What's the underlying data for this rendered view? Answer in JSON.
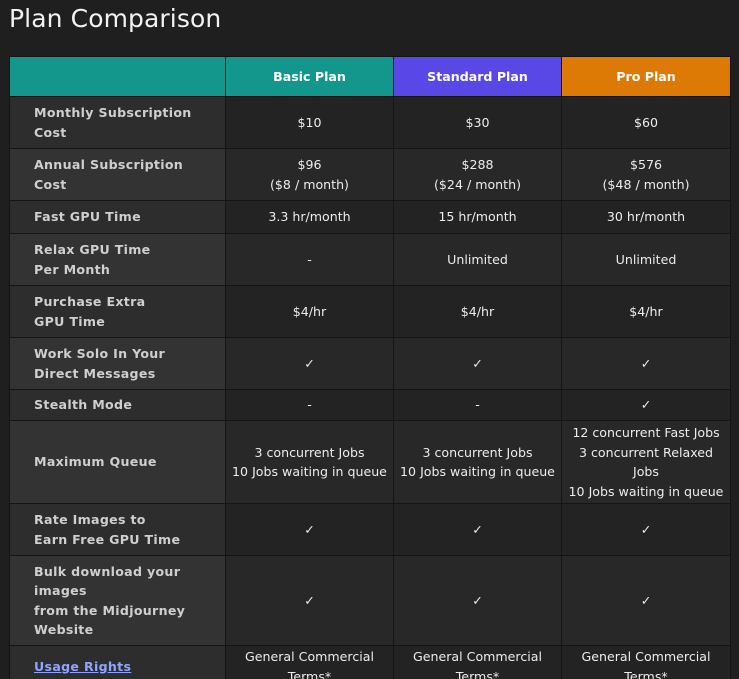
{
  "page": {
    "title": "Plan Comparison"
  },
  "plans": [
    {
      "name": "Basic Plan",
      "color": "#13978d"
    },
    {
      "name": "Standard Plan",
      "color": "#5a48e6"
    },
    {
      "name": "Pro Plan",
      "color": "#dd7a06"
    }
  ],
  "rows": [
    {
      "label": [
        "Monthly Subscription",
        "Cost"
      ],
      "values": [
        [
          "$10"
        ],
        [
          "$30"
        ],
        [
          "$60"
        ]
      ]
    },
    {
      "label": [
        "Annual Subscription Cost"
      ],
      "values": [
        [
          "$96",
          "($8 / month)"
        ],
        [
          "$288",
          "($24 / month)"
        ],
        [
          "$576",
          "($48 / month)"
        ]
      ]
    },
    {
      "label": [
        "Fast GPU Time"
      ],
      "values": [
        [
          "3.3 hr/month"
        ],
        [
          "15 hr/month"
        ],
        [
          "30 hr/month"
        ]
      ]
    },
    {
      "label": [
        "Relax GPU Time",
        "Per Month"
      ],
      "values": [
        [
          "-"
        ],
        [
          "Unlimited"
        ],
        [
          "Unlimited"
        ]
      ]
    },
    {
      "label": [
        "Purchase Extra",
        "GPU Time"
      ],
      "values": [
        [
          "$4/hr"
        ],
        [
          "$4/hr"
        ],
        [
          "$4/hr"
        ]
      ]
    },
    {
      "label": [
        "Work Solo In Your",
        "Direct Messages"
      ],
      "values": [
        [
          "✓"
        ],
        [
          "✓"
        ],
        [
          "✓"
        ]
      ]
    },
    {
      "label": [
        "Stealth Mode"
      ],
      "values": [
        [
          "-"
        ],
        [
          "-"
        ],
        [
          "✓"
        ]
      ]
    },
    {
      "label": [
        "Maximum Queue"
      ],
      "values": [
        [
          "3 concurrent Jobs",
          "10 Jobs waiting in queue"
        ],
        [
          "3 concurrent Jobs",
          "10 Jobs waiting in queue"
        ],
        [
          "12 concurrent Fast Jobs",
          "3 concurrent Relaxed",
          "Jobs",
          "10 Jobs waiting in queue"
        ]
      ]
    },
    {
      "label": [
        "Rate Images to",
        "Earn Free GPU Time"
      ],
      "values": [
        [
          "✓"
        ],
        [
          "✓"
        ],
        [
          "✓"
        ]
      ]
    },
    {
      "label": [
        "Bulk download your",
        "images",
        "from the Midjourney",
        "Website"
      ],
      "values": [
        [
          "✓"
        ],
        [
          "✓"
        ],
        [
          "✓"
        ]
      ]
    },
    {
      "label": [
        "Usage Rights"
      ],
      "label_is_link": true,
      "values": [
        [
          "General Commercial",
          "Terms*"
        ],
        [
          "General Commercial",
          "Terms*"
        ],
        [
          "General Commercial",
          "Terms*"
        ]
      ]
    }
  ]
}
